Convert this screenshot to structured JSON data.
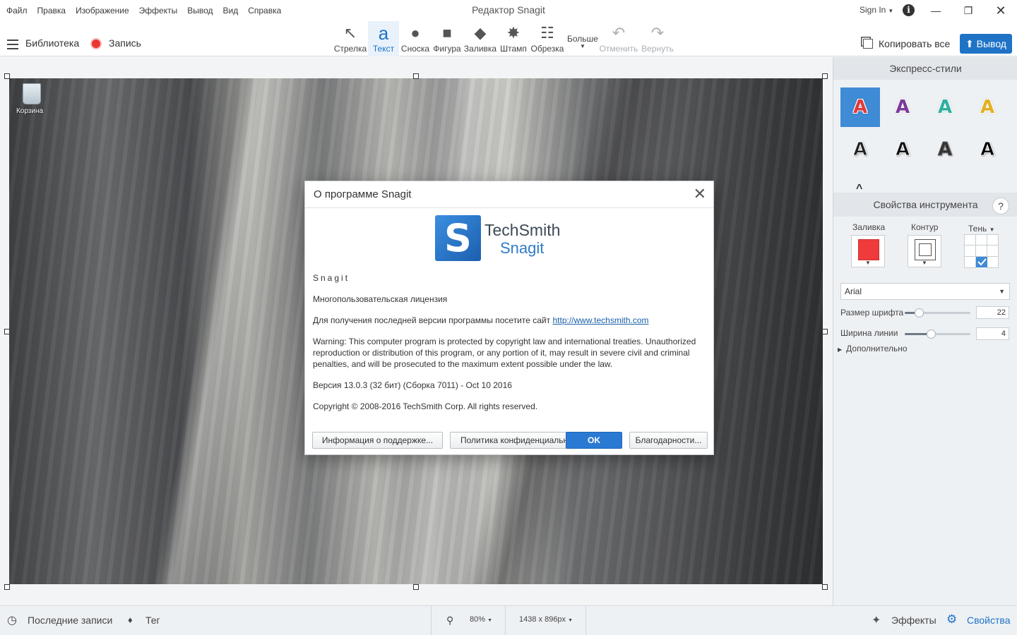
{
  "app": {
    "title": "Редактор Snagit",
    "menu": [
      "Файл",
      "Правка",
      "Изображение",
      "Эффекты",
      "Вывод",
      "Вид",
      "Справка"
    ],
    "sign_in": "Sign In"
  },
  "toolbar": {
    "library": "Библиотека",
    "record": "Запись",
    "tools": [
      {
        "label": "Стрелка",
        "icon": "arrow-icon"
      },
      {
        "label": "Текст",
        "icon": "text-icon",
        "active": true
      },
      {
        "label": "Сноска",
        "icon": "callout-icon"
      },
      {
        "label": "Фигура",
        "icon": "shape-icon"
      },
      {
        "label": "Заливка",
        "icon": "fill-icon"
      },
      {
        "label": "Штамп",
        "icon": "stamp-icon"
      },
      {
        "label": "Обрезка",
        "icon": "crop-icon"
      },
      {
        "label": "Отменить",
        "icon": "undo-icon",
        "disabled": true
      },
      {
        "label": "Вернуть",
        "icon": "redo-icon",
        "disabled": true
      }
    ],
    "more": "Больше",
    "copy_all": "Копировать все",
    "share": "Вывод"
  },
  "canvas": {
    "desktop_icon_label": "Корзина"
  },
  "dialog": {
    "title": "О программе Snagit",
    "logo_company": "TechSmith",
    "logo_product": "Snagit",
    "product_name": "Snagit",
    "license": "Многопользовательская лицензия",
    "update_text": "Для получения последней версии программы посетите сайт",
    "update_link": "http://www.techsmith.com",
    "warning": "Warning: This computer program is protected by copyright law and international treaties. Unauthorized reproduction or distribution of this program, or any portion of it, may result in severe civil and criminal penalties, and will be prosecuted to the maximum extent possible under the law.",
    "version": "Версия 13.0.3 (32 бит) (Сборка 7011) - Oct 10 2016",
    "copyright": "Copyright © 2008-2016 TechSmith Corp. All rights reserved.",
    "buttons": {
      "support": "Информация о поддержке...",
      "privacy": "Политика конфиденциальн",
      "ok": "OK",
      "credits": "Благодарности..."
    }
  },
  "panel": {
    "quick_styles_title": "Экспресс-стили",
    "quick_styles": [
      {
        "letter": "A",
        "color": "#e03a3a",
        "selected": true
      },
      {
        "letter": "A",
        "color": "#7a3a9a"
      },
      {
        "letter": "A",
        "color": "#2fb0a0"
      },
      {
        "letter": "A",
        "color": "#e0b020"
      },
      {
        "letter": "A",
        "color": "#222222"
      },
      {
        "letter": "A",
        "color": "#111111"
      },
      {
        "letter": "A",
        "color": "#333333"
      },
      {
        "letter": "A",
        "color": "#000000"
      }
    ],
    "tool_props_title": "Свойства инструмента",
    "help": "?",
    "fill_label": "Заливка",
    "outline_label": "Контур",
    "shadow_label": "Тень",
    "fill_color": "#ef3b3b",
    "font": "Arial",
    "font_size_label": "Размер шрифта",
    "font_size": "22",
    "font_size_fraction": 0.22,
    "line_width_label": "Ширина линии",
    "line_width": "4",
    "line_width_fraction": 0.4,
    "advanced": "Дополнительно"
  },
  "status": {
    "recent": "Последние записи",
    "tag": "Тег",
    "zoom": "80%",
    "dimensions": "1438 x 896px",
    "effects": "Эффекты",
    "properties": "Свойства"
  },
  "colors": {
    "accent": "#1f73c7",
    "record": "#e33333"
  }
}
